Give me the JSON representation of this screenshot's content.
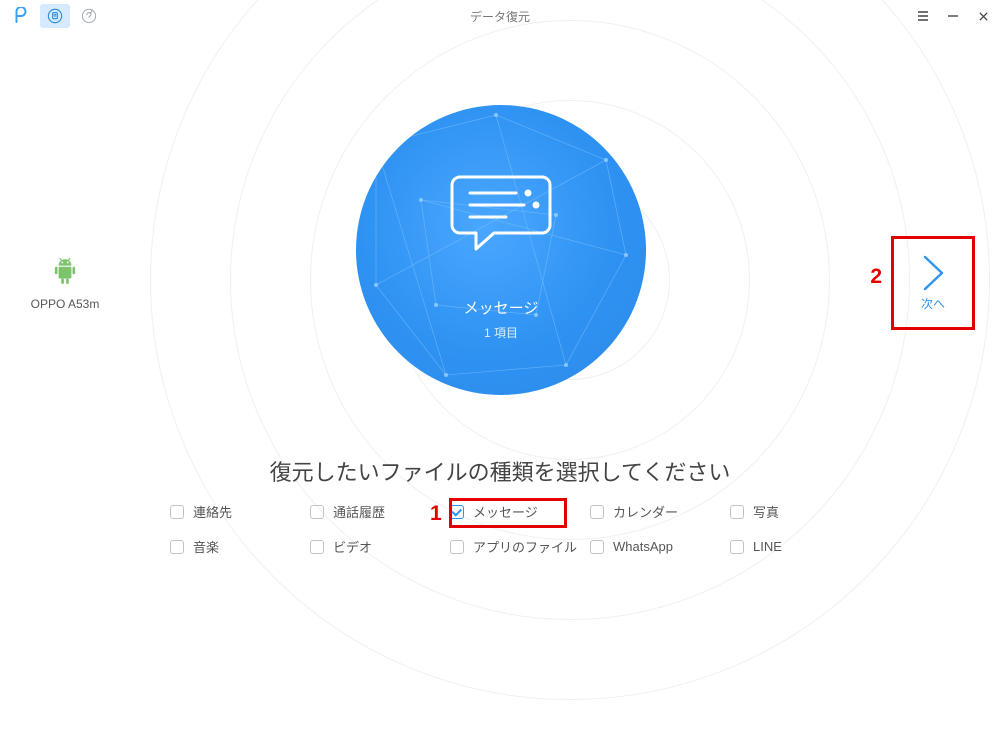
{
  "title": "データ復元",
  "device": {
    "name": "OPPO A53m"
  },
  "center": {
    "label": "メッセージ",
    "count": "1 項目"
  },
  "instruction": "復元したいファイルの種類を選択してください",
  "categories": [
    {
      "label": "連絡先",
      "checked": false
    },
    {
      "label": "通話履歴",
      "checked": false
    },
    {
      "label": "メッセージ",
      "checked": true
    },
    {
      "label": "カレンダー",
      "checked": false
    },
    {
      "label": "写真",
      "checked": false
    },
    {
      "label": "音楽",
      "checked": false
    },
    {
      "label": "ビデオ",
      "checked": false
    },
    {
      "label": "アプリのファイル",
      "checked": false
    },
    {
      "label": "WhatsApp",
      "checked": false
    },
    {
      "label": "LINE",
      "checked": false
    }
  ],
  "next": {
    "label": "次へ"
  },
  "annotations": {
    "n1": "1",
    "n2": "2"
  }
}
